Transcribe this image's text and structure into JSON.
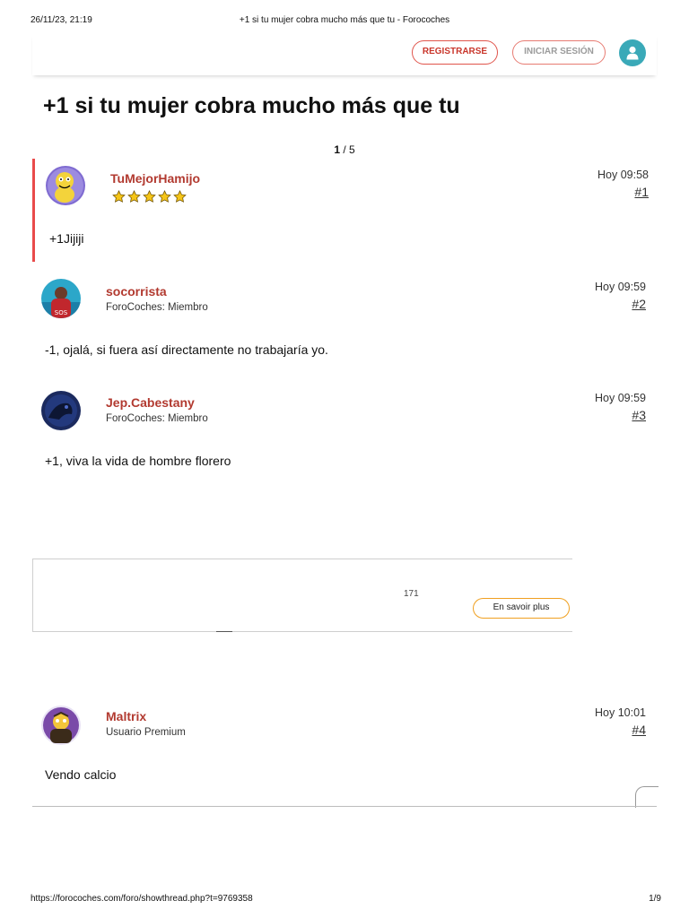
{
  "print": {
    "datetime": "26/11/23, 21:19",
    "page_title": "+1 si tu mujer cobra mucho más que tu - Forocoches",
    "url": "https://forocoches.com/foro/showthread.php?t=9769358",
    "page_counter": "1/9"
  },
  "topbar": {
    "register_label": "REGISTRARSE",
    "login_label": "INICIAR SESIÓN"
  },
  "thread": {
    "title": "+1 si tu mujer cobra mucho más que tu",
    "pager_current": "1",
    "pager_total": " / 5"
  },
  "posts": [
    {
      "username": "TuMejorHamijo",
      "role": "",
      "time": "Hoy 09:58",
      "number": "#1",
      "body": "+1Jijiji",
      "stars": 5
    },
    {
      "username": "socorrista",
      "role": "ForoCoches: Miembro",
      "time": "Hoy 09:59",
      "number": "#2",
      "body": "-1, ojalá, si fuera así directamente no trabajaría yo."
    },
    {
      "username": "Jep.Cabestany",
      "role": "ForoCoches: Miembro",
      "time": "Hoy 09:59",
      "number": "#3",
      "body": "+1, viva la vida de hombre florero"
    },
    {
      "username": "Maltrix",
      "role": "Usuario Premium",
      "time": "Hoy 10:01",
      "number": "#4",
      "body": "Vendo calcio"
    }
  ],
  "ad": {
    "count": "171",
    "button_label": "En savoir plus"
  },
  "colors": {
    "accent_red": "#e0544b",
    "username_red": "#b23a30",
    "user_button_teal": "#3aa9b8",
    "ad_button_orange": "#f0a020"
  }
}
